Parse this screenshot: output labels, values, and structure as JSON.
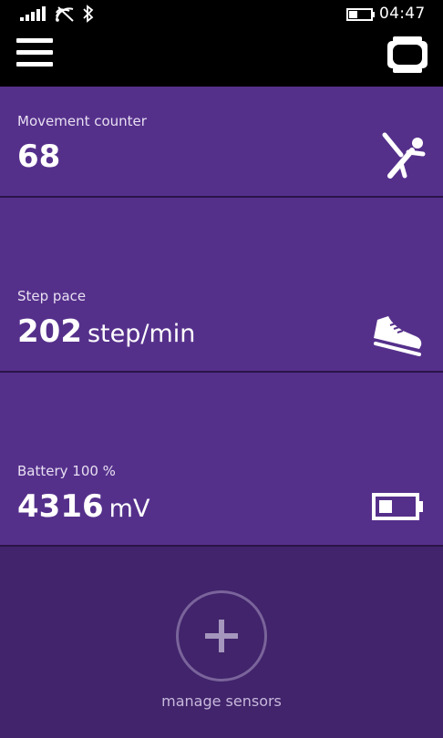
{
  "status_bar": {
    "time": "04:47",
    "signal_icon": "signal-bars-icon",
    "wifi_icon": "wifi-icon",
    "bluetooth_icon": "bluetooth-icon",
    "battery_icon": "battery-status-icon"
  },
  "app_bar": {
    "menu_icon": "hamburger-menu-icon",
    "device_icon": "wristband-device-icon"
  },
  "tiles": [
    {
      "label": "Movement counter",
      "value": "68",
      "unit": "",
      "icon": "running-figure-icon"
    },
    {
      "label": "Step pace",
      "value": "202",
      "unit": "step/min",
      "icon": "sneaker-icon"
    },
    {
      "label": "Battery 100 %",
      "value": "4316",
      "unit": "mV",
      "icon": "battery-icon"
    }
  ],
  "manage": {
    "label": "manage sensors",
    "icon": "plus-icon"
  },
  "colors": {
    "tile_background": "#55308b",
    "manage_background": "#41246b",
    "bar_background": "#000000"
  }
}
